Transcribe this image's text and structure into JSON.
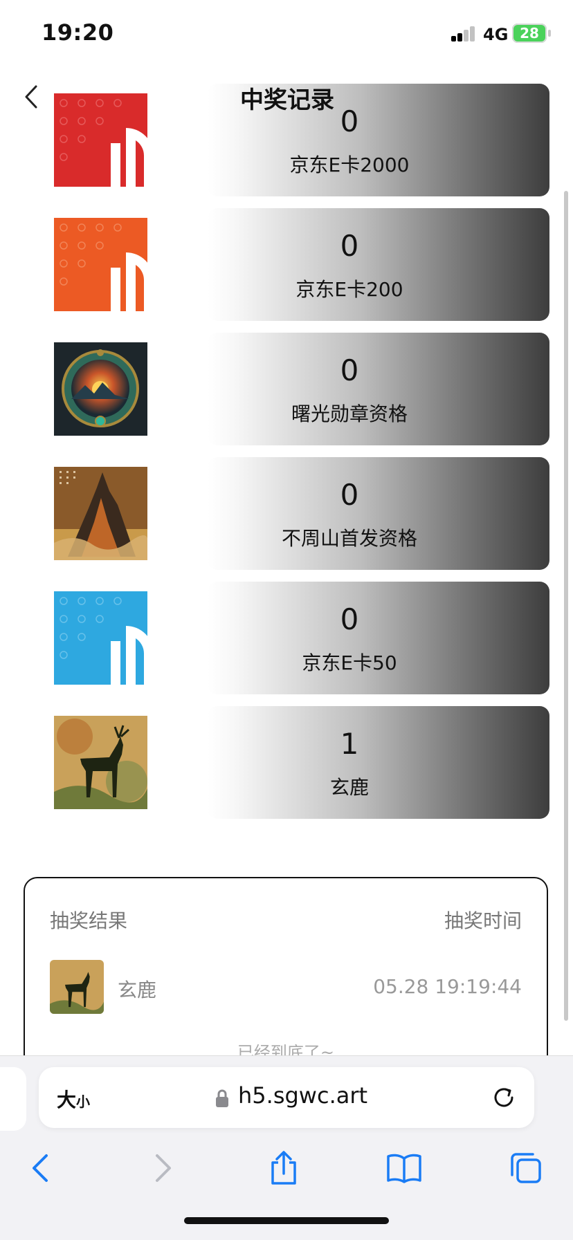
{
  "status_bar": {
    "time": "19:20",
    "network": "4G",
    "battery": "28"
  },
  "header": {
    "title": "中奖记录"
  },
  "prizes": [
    {
      "count": "0",
      "name": "京东E卡2000",
      "image": "jd-card-red",
      "color": "#d92b2b"
    },
    {
      "count": "0",
      "name": "京东E卡200",
      "image": "jd-card-orange",
      "color": "#ec5a24"
    },
    {
      "count": "0",
      "name": "曙光勋章资格",
      "image": "sunrise-medal"
    },
    {
      "count": "0",
      "name": "不周山首发资格",
      "image": "mountain-painting"
    },
    {
      "count": "0",
      "name": "京东E卡50",
      "image": "jd-card-blue",
      "color": "#2ea8e0"
    },
    {
      "count": "1",
      "name": "玄鹿",
      "image": "deer-painting"
    }
  ],
  "result": {
    "header_left": "抽奖结果",
    "header_right": "抽奖时间",
    "rows": [
      {
        "name": "玄鹿",
        "time": "05.28 19:19:44"
      }
    ],
    "end_text": "已经到底了~"
  },
  "browser": {
    "text_size_big": "大",
    "text_size_small": "小",
    "url": "h5.sgwc.art"
  },
  "colors": {
    "accent_blue": "#1a7cf5",
    "battery_green": "#4bd25b"
  }
}
